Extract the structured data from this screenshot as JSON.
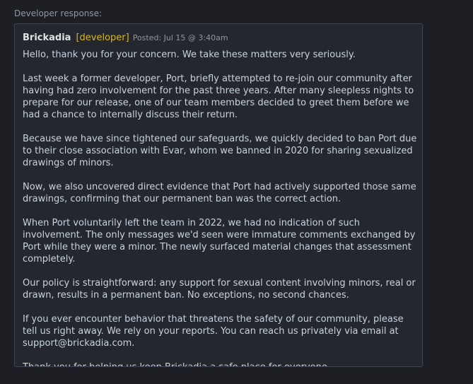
{
  "section_label": "Developer response:",
  "response": {
    "author": "Brickadia",
    "role": "[developer]",
    "posted": "Posted: Jul 15 @ 3:40am",
    "paragraphs": [
      "Hello, thank you for your concern. We take these matters very seriously.",
      "Last week a former developer, Port, briefly attempted to re-join our community after having had zero involvement for the past three years. After many sleepless nights to prepare for our release, one of our team members decided to greet them before we had a chance to internally discuss their return.",
      "Because we have since tightened our safeguards, we quickly decided to ban Port due to their close association with Evar, whom we banned in 2020 for sharing sexualized drawings of minors.",
      "Now, we also uncovered direct evidence that Port had actively supported those same drawings, confirming that our permanent ban was the correct action.",
      "When Port voluntarily left the team in 2022, we had no indication of such involvement. The only messages we'd seen were immature comments exchanged by Port while they were a minor. The newly surfaced material changes that assessment completely.",
      "Our policy is straightforward: any support for sexual content involving minors, real or drawn, results in a permanent ban. No exceptions, no second chances.",
      "If you ever encounter behavior that threatens the safety of our community, please tell us right away. We rely on your reports. You can reach us privately via email at support@brickadia.com.",
      "Thank you for helping us keep Brickadia a safe place for everyone."
    ]
  },
  "colors": {
    "background": "#1d1f24",
    "box_background": "#24272d",
    "box_border": "#3d4350",
    "developer_tag": "#d8b629",
    "text": "#c6d4df",
    "muted": "#8f98a0"
  }
}
